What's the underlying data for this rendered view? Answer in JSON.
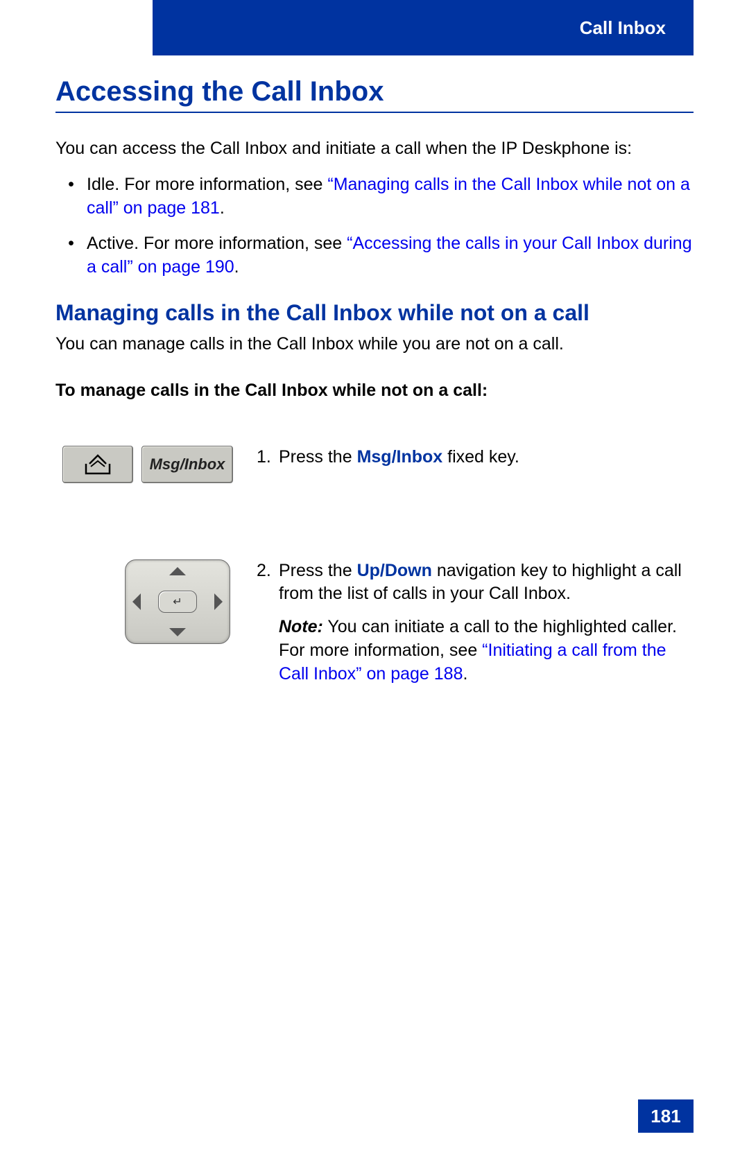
{
  "header": {
    "section": "Call Inbox"
  },
  "page_number": "181",
  "h1": "Accessing the Call Inbox",
  "intro": "You can access the Call Inbox and initiate a call when the IP Deskphone is:",
  "bullets": [
    {
      "lead": "Idle. For more information, see ",
      "xref": "“Managing calls in the Call Inbox while not on a call” on page 181",
      "tail": "."
    },
    {
      "lead": "Active. For more information, see ",
      "xref": "“Accessing the calls in your Call Inbox during a call” on page 190",
      "tail": "."
    }
  ],
  "h2": "Managing calls in the Call Inbox while not on a call",
  "h2_intro": "You can manage calls in the Call Inbox while you are not on a call.",
  "procedure_title": "To manage calls in the Call Inbox while not on a call:",
  "steps": {
    "s1": {
      "num": "1.",
      "pre": "Press the ",
      "key": "Msg/Inbox",
      "post": " fixed key.",
      "key_label": "Msg/Inbox"
    },
    "s2": {
      "num": "2.",
      "pre": "Press the ",
      "key": "Up/Down",
      "post": " navigation key to highlight a call from the list of calls in your Call Inbox.",
      "note_label": "Note:",
      "note_pre": "  You can initiate a call to the highlighted caller. For more information, see ",
      "note_xref": "“Initiating a call from the Call Inbox” on page 188",
      "note_tail": "."
    }
  }
}
